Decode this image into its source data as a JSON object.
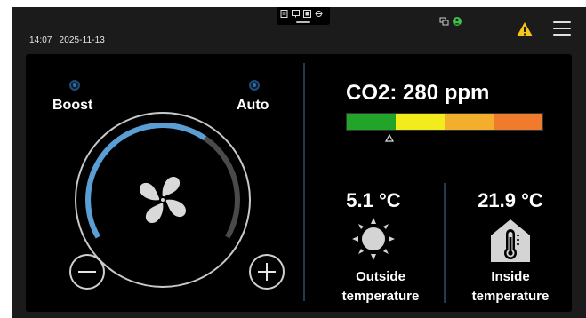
{
  "status_bar": {
    "time": "14:07",
    "date": "2025-11-13"
  },
  "icons": {
    "warning": "warning-icon",
    "menu": "hamburger-menu-icon",
    "fan": "fan-icon",
    "sun": "sun-icon",
    "house_thermometer": "house-thermometer-icon"
  },
  "modes": {
    "boost_label": "Boost",
    "auto_label": "Auto"
  },
  "fan_level": 0.66,
  "co2": {
    "label": "CO2: 280 ppm",
    "scale_colors": [
      "#22a32a",
      "#f2ec1c",
      "#f3ae2c",
      "#f07b2c"
    ],
    "marker_position": 0.14
  },
  "outside": {
    "value": "5.1 °C",
    "label_line1": "Outside",
    "label_line2": "temperature"
  },
  "inside": {
    "value": "21.9 °C",
    "label_line1": "Inside",
    "label_line2": "temperature"
  },
  "colors": {
    "accent": "#5a9ed6",
    "warning": "#f5c518",
    "status_ok": "#3fc04a"
  }
}
